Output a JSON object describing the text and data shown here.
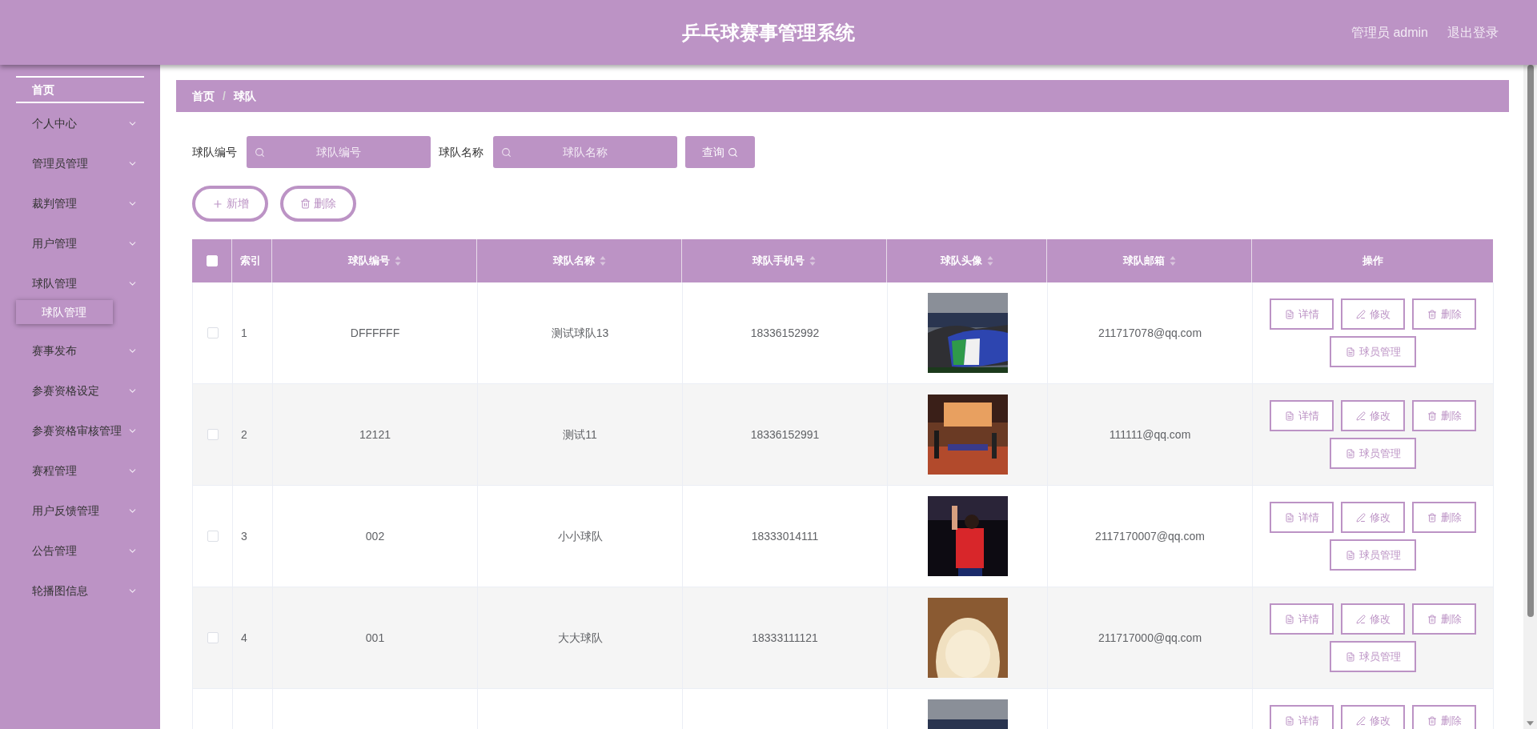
{
  "header": {
    "title": "乒乓球赛事管理系统",
    "user": "管理员 admin",
    "logout": "退出登录"
  },
  "sidebar": {
    "items": [
      {
        "label": "首页",
        "kind": "home"
      },
      {
        "label": "个人中心",
        "kind": "menu"
      },
      {
        "label": "管理员管理",
        "kind": "menu"
      },
      {
        "label": "裁判管理",
        "kind": "menu"
      },
      {
        "label": "用户管理",
        "kind": "menu"
      },
      {
        "label": "球队管理",
        "kind": "menu",
        "children": [
          {
            "label": "球队管理",
            "selected": true
          }
        ]
      },
      {
        "label": "赛事发布",
        "kind": "menu"
      },
      {
        "label": "参赛资格设定",
        "kind": "menu"
      },
      {
        "label": "参赛资格审核管理",
        "kind": "menu"
      },
      {
        "label": "赛程管理",
        "kind": "menu"
      },
      {
        "label": "用户反馈管理",
        "kind": "menu"
      },
      {
        "label": "公告管理",
        "kind": "menu"
      },
      {
        "label": "轮播图信息",
        "kind": "menu"
      }
    ]
  },
  "breadcrumb": {
    "items": [
      "首页",
      "球队"
    ],
    "separator": "/"
  },
  "search": {
    "fields": [
      {
        "label": "球队编号",
        "placeholder": "球队编号"
      },
      {
        "label": "球队名称",
        "placeholder": "球队名称"
      }
    ],
    "button": "查询"
  },
  "toolbar": {
    "add": "新增",
    "delete": "删除"
  },
  "table": {
    "columns": [
      {
        "kind": "checkbox",
        "checked": false
      },
      {
        "kind": "text",
        "label": "索引",
        "sortable": false
      },
      {
        "kind": "text",
        "label": "球队编号",
        "sortable": true
      },
      {
        "kind": "text",
        "label": "球队名称",
        "sortable": true
      },
      {
        "kind": "text",
        "label": "球队手机号",
        "sortable": true
      },
      {
        "kind": "text",
        "label": "球队头像",
        "sortable": true
      },
      {
        "kind": "text",
        "label": "球队邮箱",
        "sortable": true
      },
      {
        "kind": "text",
        "label": "操作",
        "sortable": false
      }
    ],
    "rows": [
      {
        "checked": false,
        "index": "1",
        "code": "DFFFFFF",
        "name": "测试球队13",
        "phone": "18336152992",
        "avatar": {
          "kind": "picture"
        },
        "email": "211717078@qq.com",
        "actions": [
          "详情",
          "修改",
          "删除",
          "球员管理"
        ]
      },
      {
        "checked": false,
        "index": "2",
        "code": "12121",
        "name": "测试11",
        "phone": "18336152991",
        "avatar": {
          "kind": "picture"
        },
        "email": "111111@qq.com",
        "actions": [
          "详情",
          "修改",
          "删除",
          "球员管理"
        ]
      },
      {
        "checked": false,
        "index": "3",
        "code": "002",
        "name": "小小球队",
        "phone": "18333014111",
        "avatar": {
          "kind": "picture"
        },
        "email": "2117170007@qq.com",
        "actions": [
          "详情",
          "修改",
          "删除",
          "球员管理"
        ]
      },
      {
        "checked": false,
        "index": "4",
        "code": "001",
        "name": "大大球队",
        "phone": "18333111121",
        "avatar": {
          "kind": "picture"
        },
        "email": "211717000@qq.com",
        "actions": [
          "详情",
          "修改",
          "删除",
          "球员管理"
        ]
      },
      {
        "avatar": {
          "kind": "picture"
        },
        "actions": [
          "详情",
          "修改",
          "删除"
        ]
      }
    ]
  }
}
